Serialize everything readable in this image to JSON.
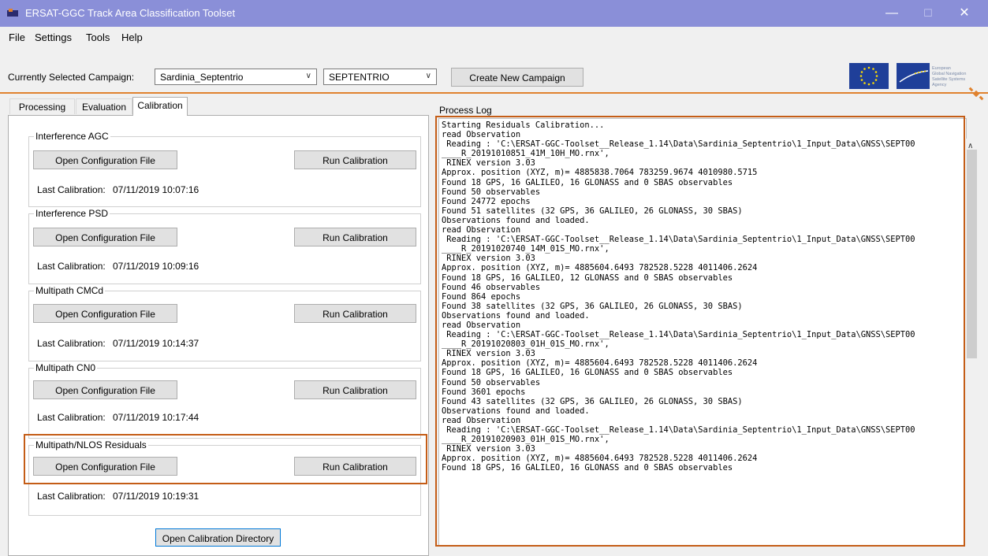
{
  "window": {
    "title": "ERSAT-GGC Track Area Classification Toolset",
    "minimize_glyph": "—",
    "maximize_glyph": "☐",
    "close_glyph": "✕"
  },
  "menu": [
    "File",
    "Settings",
    "Tools",
    "Help"
  ],
  "toolbar": {
    "campaign_label": "Currently Selected Campaign:",
    "campaign_value": "Sardinia_Septentrio",
    "receiver_value": "SEPTENTRIO",
    "create_button": "Create New Campaign",
    "agency_logo_text": [
      "European",
      "Global Navigation",
      "Satellite Systems",
      "Agency"
    ]
  },
  "tabs": [
    "Processing",
    "Evaluation",
    "Calibration"
  ],
  "active_tab": "Calibration",
  "calibration": {
    "groups": [
      {
        "title": "Interference AGC",
        "open_button": "Open Configuration File",
        "run_button": "Run Calibration",
        "last_label": "Last Calibration:",
        "last_value": "07/11/2019 10:07:16"
      },
      {
        "title": "Interference PSD",
        "open_button": "Open Configuration File",
        "run_button": "Run Calibration",
        "last_label": "Last Calibration:",
        "last_value": "07/11/2019 10:09:16"
      },
      {
        "title": "Multipath CMCd",
        "open_button": "Open Configuration File",
        "run_button": "Run Calibration",
        "last_label": "Last Calibration:",
        "last_value": "07/11/2019 10:14:37"
      },
      {
        "title": "Multipath CN0",
        "open_button": "Open Configuration File",
        "run_button": "Run Calibration",
        "last_label": "Last Calibration:",
        "last_value": "07/11/2019 10:17:44"
      },
      {
        "title": "Multipath/NLOS Residuals",
        "open_button": "Open Configuration File",
        "run_button": "Run Calibration",
        "last_label": "Last Calibration:",
        "last_value": "07/11/2019 10:19:31"
      }
    ],
    "open_dir_button": "Open Calibration Directory"
  },
  "process_log": {
    "label": "Process Log",
    "lines": [
      "Starting Residuals Calibration...",
      "read Observation",
      " Reading : 'C:\\ERSAT-GGC-Toolset__Release_1.14\\Data\\Sardinia_Septentrio\\1_Input_Data\\GNSS\\SEPT00",
      "____R_20191010851_41M_10H_MO.rnx',",
      " RINEX version 3.03",
      "Approx. position (XYZ, m)= 4885838.7064 783259.9674 4010980.5715",
      "Found 18 GPS, 16 GALILEO, 16 GLONASS and 0 SBAS observables",
      "Found 50 observables",
      "Found 24772 epochs",
      "Found 51 satellites (32 GPS, 36 GALILEO, 26 GLONASS, 30 SBAS)",
      "Observations found and loaded.",
      "read Observation",
      " Reading : 'C:\\ERSAT-GGC-Toolset__Release_1.14\\Data\\Sardinia_Septentrio\\1_Input_Data\\GNSS\\SEPT00",
      "____R_20191020740_14M_01S_MO.rnx',",
      " RINEX version 3.03",
      "Approx. position (XYZ, m)= 4885604.6493 782528.5228 4011406.2624",
      "Found 18 GPS, 16 GALILEO, 12 GLONASS and 0 SBAS observables",
      "Found 46 observables",
      "Found 864 epochs",
      "Found 38 satellites (32 GPS, 36 GALILEO, 26 GLONASS, 30 SBAS)",
      "Observations found and loaded.",
      "read Observation",
      " Reading : 'C:\\ERSAT-GGC-Toolset__Release_1.14\\Data\\Sardinia_Septentrio\\1_Input_Data\\GNSS\\SEPT00",
      "____R_20191020803_01H_01S_MO.rnx',",
      " RINEX version 3.03",
      "Approx. position (XYZ, m)= 4885604.6493 782528.5228 4011406.2624",
      "Found 18 GPS, 16 GALILEO, 16 GLONASS and 0 SBAS observables",
      "Found 50 observables",
      "Found 3601 epochs",
      "Found 43 satellites (32 GPS, 36 GALILEO, 26 GLONASS, 30 SBAS)",
      "Observations found and loaded.",
      "read Observation",
      " Reading : 'C:\\ERSAT-GGC-Toolset__Release_1.14\\Data\\Sardinia_Septentrio\\1_Input_Data\\GNSS\\SEPT00",
      "____R_20191020903_01H_01S_MO.rnx',",
      " RINEX version 3.03",
      "Approx. position (XYZ, m)= 4885604.6493 782528.5228 4011406.2624",
      "Found 18 GPS, 16 GALILEO, 16 GLONASS and 0 SBAS observables"
    ]
  },
  "colors": {
    "titlebar": "#8a8fd8",
    "accent_orange": "#e0822e",
    "highlight_box": "#c45d17",
    "eu_flag": "#1f3f99"
  }
}
